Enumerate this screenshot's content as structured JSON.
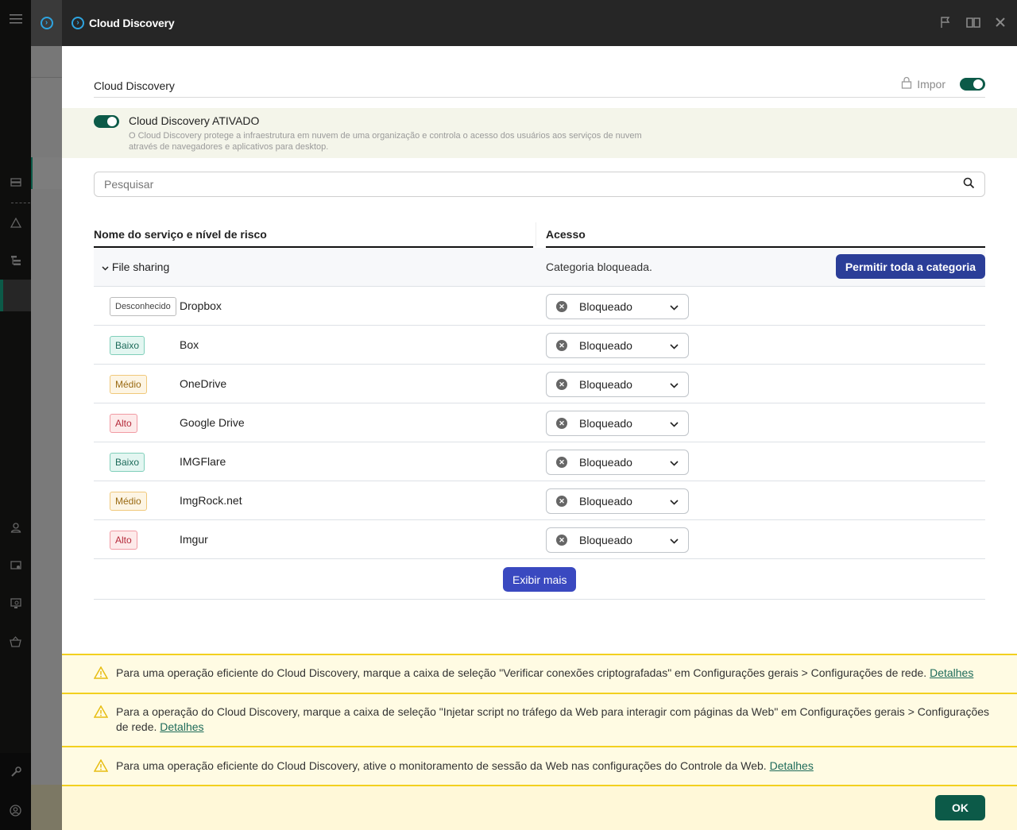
{
  "window": {
    "title": "Cloud Discovery",
    "icons": [
      "flag-icon",
      "book-icon",
      "close-icon"
    ]
  },
  "section": {
    "title": "Cloud Discovery",
    "enforce_label": "Impor",
    "enforce_on": true
  },
  "banner": {
    "title": "Cloud Discovery ATIVADO",
    "enabled": true,
    "description": "O Cloud Discovery protege a infraestrutura em nuvem de uma organização e controla o acesso dos usuários aos serviços de nuvem através de navegadores e aplicativos para desktop."
  },
  "search": {
    "placeholder": "Pesquisar",
    "value": ""
  },
  "table": {
    "columns": [
      "Nome do serviço e nível de risco",
      "Acesso"
    ],
    "category": {
      "name": "File sharing",
      "status": "Categoria bloqueada.",
      "action_label": "Permitir toda a categoria"
    },
    "rows": [
      {
        "risk": "Desconhecido",
        "risk_level": "unknown",
        "service": "Dropbox",
        "access": "Bloqueado"
      },
      {
        "risk": "Baixo",
        "risk_level": "low",
        "service": "Box",
        "access": "Bloqueado"
      },
      {
        "risk": "Médio",
        "risk_level": "medium",
        "service": "OneDrive",
        "access": "Bloqueado"
      },
      {
        "risk": "Alto",
        "risk_level": "high",
        "service": "Google Drive",
        "access": "Bloqueado"
      },
      {
        "risk": "Baixo",
        "risk_level": "low",
        "service": "IMGFlare",
        "access": "Bloqueado"
      },
      {
        "risk": "Médio",
        "risk_level": "medium",
        "service": "ImgRock.net",
        "access": "Bloqueado"
      },
      {
        "risk": "Alto",
        "risk_level": "high",
        "service": "Imgur",
        "access": "Bloqueado"
      }
    ],
    "show_more_label": "Exibir mais"
  },
  "warnings": [
    {
      "text": "Para uma operação eficiente do Cloud Discovery, marque a caixa de seleção \"Verificar conexões criptografadas\" em Configurações gerais > Configurações de rede. ",
      "link": "Detalhes"
    },
    {
      "text": "Para a operação do Cloud Discovery, marque a caixa de seleção \"Injetar script no tráfego da Web para interagir com páginas da Web\" em Configurações gerais > Configurações de rede. ",
      "link": "Detalhes"
    },
    {
      "text": "Para uma operação eficiente do Cloud Discovery, ative o monitoramento de sessão da Web nas configurações do Controle da Web. ",
      "link": "Detalhes"
    }
  ],
  "footer": {
    "ok_label": "OK"
  },
  "colors": {
    "accent_green": "#0c5a48",
    "primary_blue": "#2b3e98",
    "warning_yellow": "#f2d01f"
  }
}
